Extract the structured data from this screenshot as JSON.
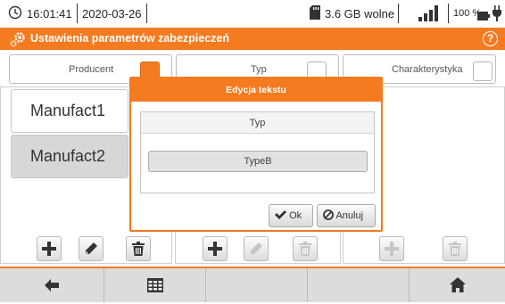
{
  "status": {
    "time": "16:01:41",
    "date": "2020-03-26",
    "storage": "3.6 GB wolne",
    "battery": "100 %"
  },
  "header": {
    "title": "Ustawienia parametrów zabezpieczeń",
    "help_symbol": "?"
  },
  "columns": [
    {
      "label": "Producent",
      "checked": true
    },
    {
      "label": "Typ",
      "checked": false
    },
    {
      "label": "Charakterystyka",
      "checked": false
    }
  ],
  "manufacturers": [
    "Manufact1",
    "Manufact2"
  ],
  "dialog": {
    "title": "Edycja tekstu",
    "field_label": "Typ",
    "value": "TypeB",
    "ok_label": "Ok",
    "cancel_label": "Anuluj"
  },
  "colors": {
    "accent": "#f47b20"
  },
  "icons": {
    "clock": "clock-icon",
    "sd_card": "sd-card-icon",
    "signal": "signal-bars-icon",
    "battery": "battery-icon",
    "plug": "plug-icon",
    "settings": "gear-icon",
    "help": "help-icon",
    "add": "plus-icon",
    "edit": "pencil-icon",
    "delete": "trash-icon",
    "back": "arrow-left-icon",
    "grid": "grid-icon",
    "home": "home-icon"
  }
}
